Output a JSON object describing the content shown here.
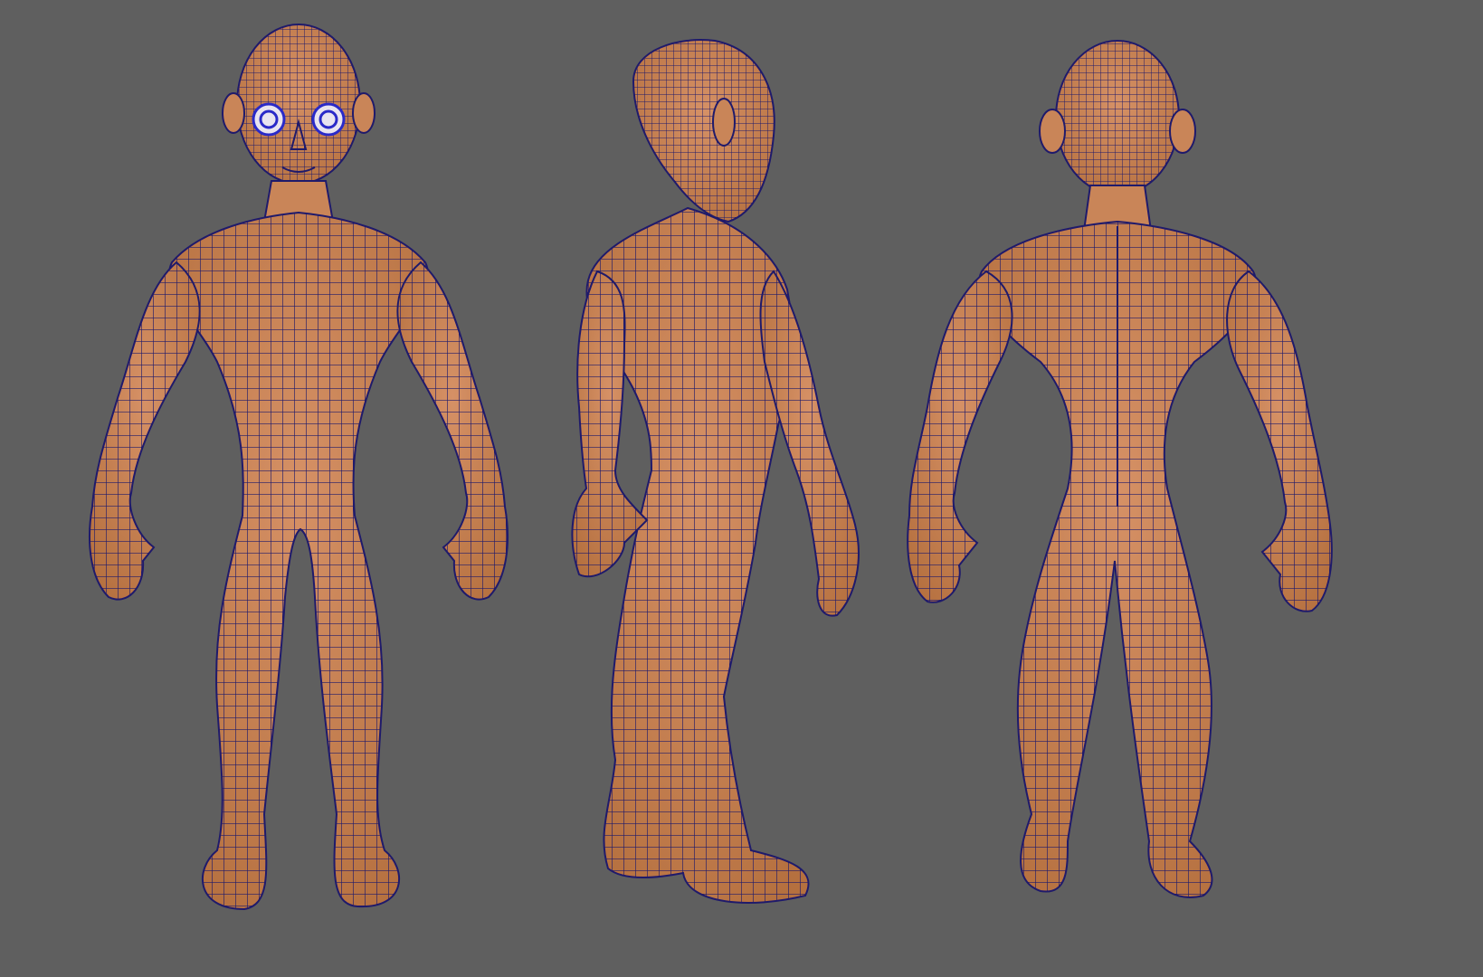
{
  "viewport": {
    "background": "#5f5f5f",
    "skin_color": "#c98558",
    "skin_shadow": "#a8653c",
    "wire_color": "#1f1a6b",
    "eye_color": "#2a2ac8"
  },
  "views": [
    {
      "id": "front",
      "icon": "character-front-view-icon"
    },
    {
      "id": "three-quarter-back",
      "icon": "character-three-quarter-back-view-icon"
    },
    {
      "id": "back",
      "icon": "character-back-view-icon"
    }
  ]
}
